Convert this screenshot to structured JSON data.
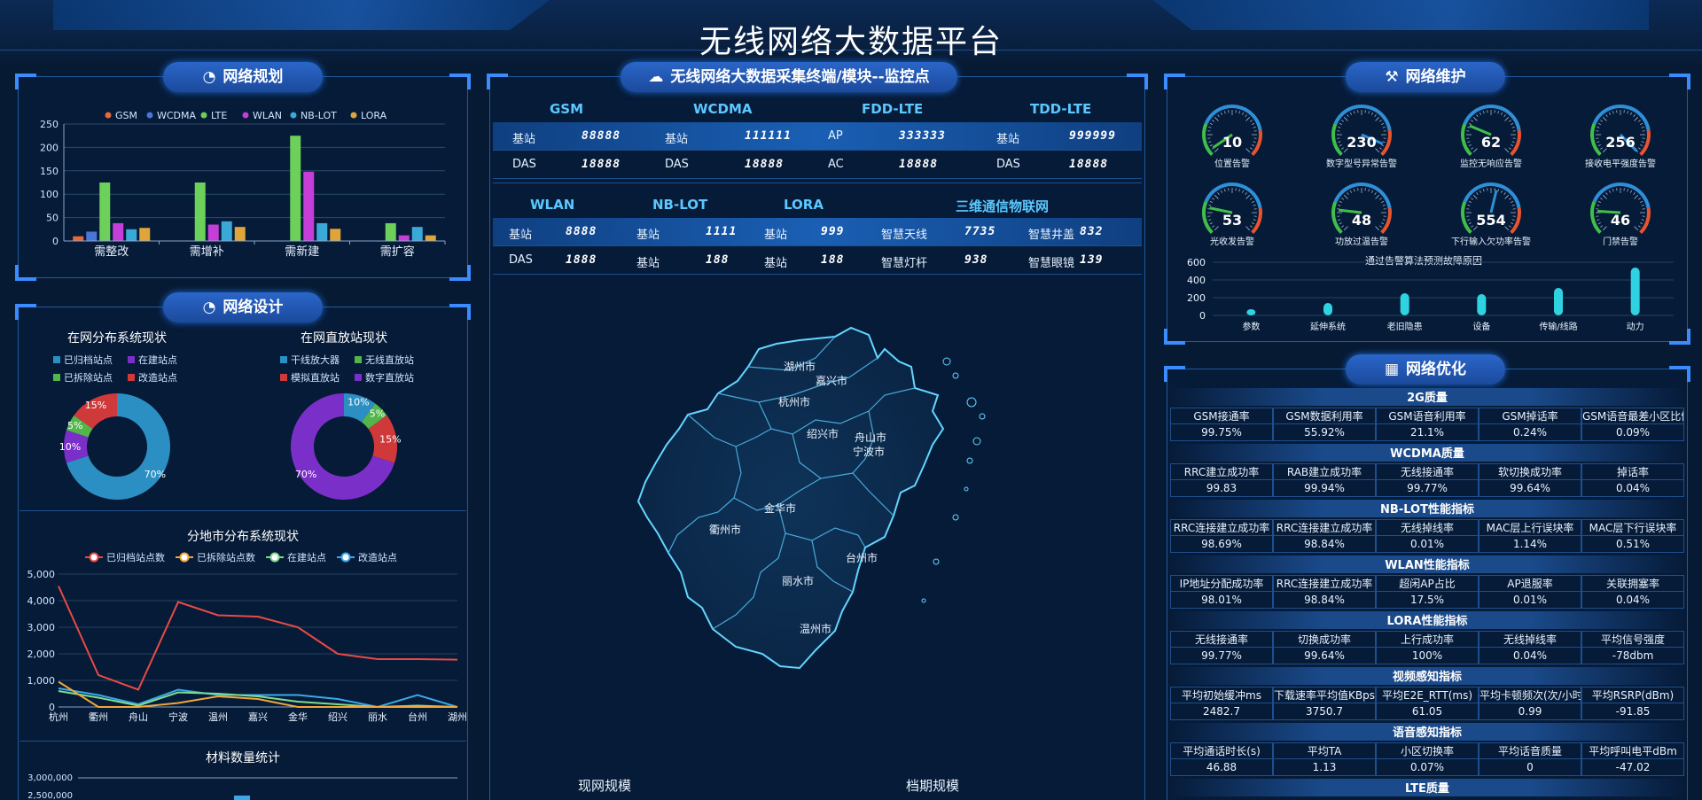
{
  "title": "无线网络大数据平台",
  "panels": {
    "planning": "网络规划",
    "design": "网络设计",
    "monitor": "无线网络大数据采集终端/模块--监控点",
    "maintenance": "网络维护",
    "optimization": "网络优化"
  },
  "planning_chart": {
    "legend": [
      "GSM",
      "WCDMA",
      "LTE",
      "WLAN",
      "NB-LOT",
      "LORA"
    ],
    "colors": [
      "#e8683a",
      "#4a74d8",
      "#6cd05a",
      "#c53ed8",
      "#3ba9d8",
      "#e0a53a"
    ],
    "categories": [
      "需整改",
      "需增补",
      "需新建",
      "需扩容"
    ],
    "yticks": [
      "0",
      "50",
      "100",
      "150",
      "200",
      "250"
    ],
    "series": [
      {
        "name": "GSM",
        "values": [
          10,
          0,
          0,
          0
        ]
      },
      {
        "name": "WCDMA",
        "values": [
          20,
          0,
          0,
          0
        ]
      },
      {
        "name": "LTE",
        "values": [
          125,
          125,
          225,
          38
        ]
      },
      {
        "name": "WLAN",
        "values": [
          38,
          35,
          148,
          12
        ]
      },
      {
        "name": "NB-LOT",
        "values": [
          25,
          42,
          38,
          30
        ]
      },
      {
        "name": "LORA",
        "values": [
          28,
          30,
          26,
          12
        ]
      }
    ],
    "ylim": [
      0,
      250
    ]
  },
  "donut1": {
    "title": "在网分布系统现状",
    "legend": [
      "已归档站点",
      "在建站点",
      "已拆除站点",
      "改造站点"
    ],
    "colors": [
      "#2b8fc4",
      "#7b2fc9",
      "#53b64a",
      "#d0393a"
    ],
    "values": [
      70,
      10,
      5,
      15
    ],
    "labels": [
      "70%",
      "10%",
      "5%",
      "15%"
    ]
  },
  "donut2": {
    "title": "在网直放站现状",
    "legend": [
      "干线放大器",
      "无线直放站",
      "模拟直放站",
      "数字直放站"
    ],
    "colors": [
      "#2b8fc4",
      "#53b64a",
      "#d0393a",
      "#7b2fc9"
    ],
    "values": [
      10,
      5,
      15,
      70
    ],
    "labels": [
      "10%",
      "5%",
      "15%",
      "70%"
    ]
  },
  "line_chart": {
    "title": "分地市分布系统现状",
    "legend": [
      "已归档站点数",
      "已拆除站点数",
      "在建站点",
      "改造站点"
    ],
    "colors": [
      "#ea4a45",
      "#f0a73a",
      "#7fdc8f",
      "#3aa8e8"
    ],
    "x": [
      "杭州",
      "衢州",
      "舟山",
      "宁波",
      "温州",
      "嘉兴",
      "金华",
      "绍兴",
      "丽水",
      "台州",
      "湖州"
    ],
    "yticks": [
      "0",
      "1,000",
      "2,000",
      "3,000",
      "4,000",
      "5,000"
    ],
    "series": [
      {
        "name": "已归档站点数",
        "values": [
          4550,
          1200,
          650,
          3950,
          3450,
          3400,
          3000,
          2000,
          1800,
          1800,
          1780
        ]
      },
      {
        "name": "已拆除站点数",
        "values": [
          950,
          0,
          0,
          150,
          400,
          300,
          0,
          0,
          0,
          0,
          0
        ]
      },
      {
        "name": "在建站点",
        "values": [
          600,
          350,
          50,
          550,
          500,
          400,
          200,
          100,
          0,
          50,
          0
        ]
      },
      {
        "name": "改造站点",
        "values": [
          700,
          450,
          100,
          650,
          450,
          450,
          450,
          300,
          0,
          450,
          0
        ]
      }
    ],
    "ylim": [
      0,
      5000
    ]
  },
  "material": {
    "title": "材料数量统计",
    "yticks": [
      "3,000,000",
      "2,500,000"
    ]
  },
  "monitor_table": {
    "group1_headers": [
      "GSM",
      "WCDMA",
      "FDD-LTE",
      "TDD-LTE"
    ],
    "group1_rows": [
      [
        [
          "基站",
          "88888"
        ],
        [
          "基站",
          "111111"
        ],
        [
          "AP",
          "333333"
        ],
        [
          "基站",
          "999999"
        ]
      ],
      [
        [
          "DAS",
          "18888"
        ],
        [
          "DAS",
          "18888"
        ],
        [
          "AC",
          "18888"
        ],
        [
          "DAS",
          "18888"
        ]
      ]
    ],
    "group2_headers": [
      "WLAN",
      "NB-LOT",
      "LORA",
      "三维通信物联网"
    ],
    "group2_rows": [
      [
        [
          "基站",
          "8888"
        ],
        [
          "基站",
          "1111"
        ],
        [
          "基站",
          "999"
        ],
        [
          "智慧天线",
          "7735"
        ],
        [
          "智慧井盖",
          "832"
        ]
      ],
      [
        [
          "DAS",
          "1888"
        ],
        [
          "基站",
          "188"
        ],
        [
          "基站",
          "188"
        ],
        [
          "智慧灯杆",
          "938"
        ],
        [
          "智慧眼镜",
          "139"
        ]
      ]
    ]
  },
  "map": {
    "cities": [
      "湖州市",
      "嘉兴市",
      "杭州市",
      "绍兴市",
      "舟山市",
      "宁波市",
      "金华市",
      "衢州市",
      "台州市",
      "丽水市",
      "温州市"
    ],
    "bottom_labels": [
      "现网规模",
      "档期规模"
    ]
  },
  "gauges": [
    {
      "value": "10",
      "label": "位置告警",
      "level": 0.04
    },
    {
      "value": "230",
      "label": "数字型号异常告警",
      "level": 0.92
    },
    {
      "value": "62",
      "label": "监控无响应告警",
      "level": 0.25
    },
    {
      "value": "256",
      "label": "接收电平强度告警",
      "level": 1.0
    },
    {
      "value": "53",
      "label": "光收发告警",
      "level": 0.21
    },
    {
      "value": "48",
      "label": "功放过温告警",
      "level": 0.19
    },
    {
      "value": "554",
      "label": "下行输入欠功率告警",
      "level": 0.55
    },
    {
      "value": "46",
      "label": "门禁告警",
      "level": 0.18
    }
  ],
  "fault_chart": {
    "title": "通过告警算法预测故障原因",
    "categories": [
      "参数",
      "延伸系统",
      "老旧隐患",
      "设备",
      "传输/线路",
      "动力"
    ],
    "values": [
      70,
      140,
      250,
      240,
      310,
      540
    ],
    "yticks": [
      "0",
      "200",
      "400",
      "600"
    ],
    "ylim": [
      0,
      600
    ]
  },
  "optimization": [
    {
      "title": "2G质量",
      "headers": [
        "GSM接通率",
        "GSM数据利用率",
        "GSM语音利用率",
        "GSM掉话率",
        "GSM语音最差小区比例"
      ],
      "values": [
        "99.75%",
        "55.92%",
        "21.1%",
        "0.24%",
        "0.09%"
      ]
    },
    {
      "title": "WCDMA质量",
      "headers": [
        "RRC建立成功率",
        "RAB建立成功率",
        "无线接通率",
        "软切换成功率",
        "掉话率"
      ],
      "values": [
        "99.83",
        "99.94%",
        "99.77%",
        "99.64%",
        "0.04%"
      ]
    },
    {
      "title": "NB-LOT性能指标",
      "headers": [
        "RRC连接建立成功率",
        "RRC连接建立成功率",
        "无线掉线率",
        "MAC层上行误块率",
        "MAC层下行误块率"
      ],
      "values": [
        "98.69%",
        "98.84%",
        "0.01%",
        "1.14%",
        "0.51%"
      ]
    },
    {
      "title": "WLAN性能指标",
      "headers": [
        "IP地址分配成功率",
        "RRC连接建立成功率",
        "超闲AP占比",
        "AP退服率",
        "关联拥塞率"
      ],
      "values": [
        "98.01%",
        "98.84%",
        "17.5%",
        "0.01%",
        "0.04%"
      ]
    },
    {
      "title": "LORA性能指标",
      "headers": [
        "无线接通率",
        "切换成功率",
        "上行成功率",
        "无线掉线率",
        "平均信号强度"
      ],
      "values": [
        "99.77%",
        "99.64%",
        "100%",
        "0.04%",
        "-78dbm"
      ]
    },
    {
      "title": "视频感知指标",
      "headers": [
        "平均初始缓冲ms",
        "下载速率平均值KBps",
        "平均E2E_RTT(ms)",
        "平均卡顿频次(次/小时)",
        "平均RSRP(dBm)"
      ],
      "values": [
        "2482.7",
        "3750.7",
        "61.05",
        "0.99",
        "-91.85"
      ]
    },
    {
      "title": "语音感知指标",
      "headers": [
        "平均通话时长(s)",
        "平均TA",
        "小区切换率",
        "平均话音质量",
        "平均呼叫电平dBm"
      ],
      "values": [
        "46.88",
        "1.13",
        "0.07%",
        "0",
        "-47.02"
      ]
    },
    {
      "title": "LTE质量",
      "headers": [],
      "values": []
    }
  ]
}
